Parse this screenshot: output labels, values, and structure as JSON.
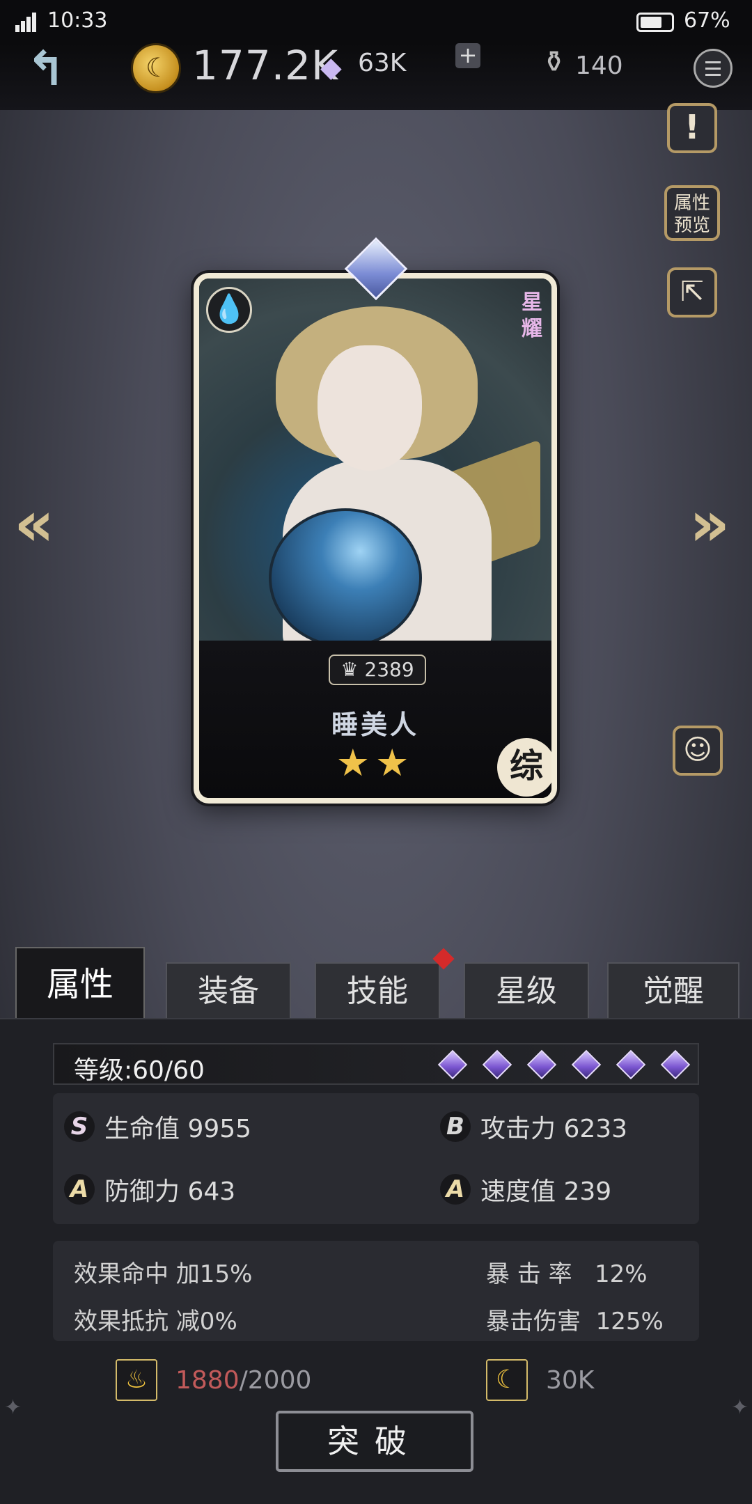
{
  "status": {
    "time": "10:33",
    "battery": "67%"
  },
  "currency": {
    "gold": "177.2K",
    "gems": "63K",
    "plus": "+",
    "ink": "140"
  },
  "side_buttons": {
    "alert": "!",
    "preview": "属性预览"
  },
  "card": {
    "rank": "星耀",
    "power": "2389",
    "name": "睡美人",
    "stars": "★★",
    "class": "综"
  },
  "tabs": [
    {
      "label": "属性"
    },
    {
      "label": "装备"
    },
    {
      "label": "技能"
    },
    {
      "label": "星级"
    },
    {
      "label": "觉醒"
    }
  ],
  "panel": {
    "level": "等级:60/60",
    "level_gems_count": 6,
    "stats": [
      {
        "grade": "S",
        "label": "生命值 9955"
      },
      {
        "grade": "B",
        "label": "攻击力 6233"
      },
      {
        "grade": "A",
        "label": "防御力 643"
      },
      {
        "grade": "A",
        "label": "速度值 239"
      }
    ],
    "extras": [
      {
        "label": "效果命中 加15%"
      },
      {
        "label": "暴 击 率   12%"
      },
      {
        "label": "效果抵抗 减0%"
      },
      {
        "label": "暴击伤害  125%"
      }
    ],
    "resource_1": {
      "current": "1880",
      "total": "/2000"
    },
    "resource_2": {
      "value": "30K"
    },
    "breakthrough_button": "突破"
  },
  "icons": {
    "back": "back-arrow-icon",
    "gold": "gold-coin-icon",
    "gem": "diamond-icon",
    "ink": "ink-bottle-icon",
    "menu": "menu-icon",
    "water": "water-drop-icon"
  }
}
